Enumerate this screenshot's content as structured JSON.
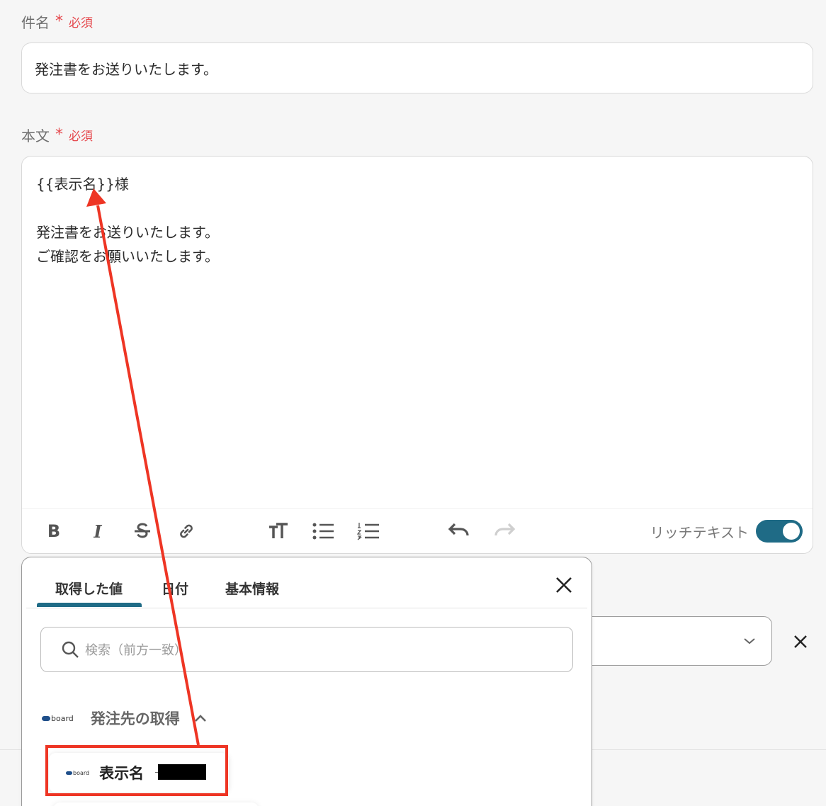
{
  "subject": {
    "label": "件名",
    "star": "*",
    "required": "必須",
    "value": "発注書をお送りいたします。"
  },
  "body": {
    "label": "本文",
    "star": "*",
    "required": "必須",
    "lines": [
      "{{表示名}}様",
      "",
      "発注書をお送りいたします。",
      "ご確認をお願いいたします。"
    ]
  },
  "toolbar": {
    "bold": "B",
    "italic": "I",
    "rich_text_label": "リッチテキスト",
    "rich_text_enabled": true
  },
  "popup": {
    "tabs": [
      {
        "label": "取得した値",
        "active": true
      },
      {
        "label": "日付",
        "active": false
      },
      {
        "label": "基本情報",
        "active": false
      }
    ],
    "search_placeholder": "検索（前方一致）",
    "group": {
      "logo_text": "board",
      "label": "発注先の取得",
      "expanded": true
    },
    "item": {
      "logo_text": "board",
      "label": "表示名"
    }
  },
  "colors": {
    "accent": "#1f6b86",
    "required": "#e5484d",
    "annotation": "#ee3524"
  }
}
